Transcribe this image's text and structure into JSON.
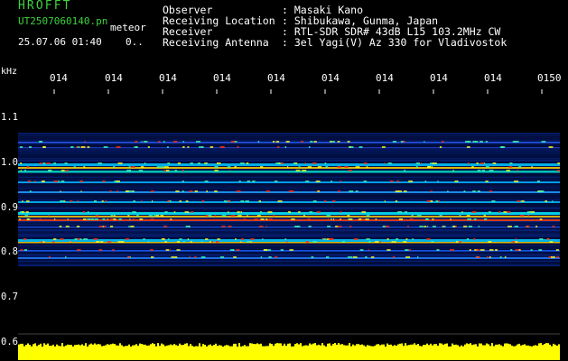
{
  "header": {
    "logo": "HROFFT",
    "filename": "UT2507060140.pn",
    "tag": "meteor",
    "datetime": "25.07.06 01:40",
    "code": "0..",
    "rows": [
      {
        "label": "Observer",
        "value": ": Masaki Kano"
      },
      {
        "label": "Receiving Location",
        "value": ": Shibukawa, Gunma, Japan"
      },
      {
        "label": "Receiver",
        "value": ": RTL-SDR SDR# 43dB L15 103.2MHz CW"
      },
      {
        "label": "Receiving Antenna",
        "value": ": 3el Yagi(V) Az 330 for Vladivostok"
      }
    ]
  },
  "axis": {
    "unit": "kHz",
    "y_ticks": [
      "1.1",
      "1.0",
      "0.9",
      "0.8",
      "0.7",
      "0.6"
    ],
    "x_ticks": [
      "014",
      "014",
      "014",
      "014",
      "014",
      "014",
      "014",
      "014",
      "014",
      "0150"
    ]
  },
  "colors": {
    "label_green": "#3fd23f",
    "text_white": "#ffffff",
    "signal_yellow": "#ffff00",
    "background": "#000000"
  }
}
